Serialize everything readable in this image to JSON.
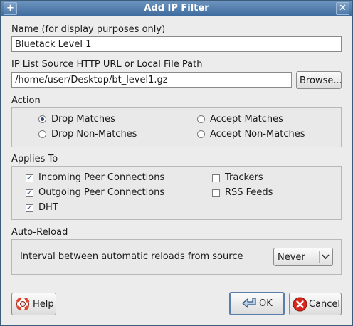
{
  "window": {
    "title": "Add IP Filter",
    "menu_icon": "plus-icon",
    "close_icon": "close-icon"
  },
  "name_field": {
    "label": "Name (for display purposes only)",
    "value": "Bluetack Level 1"
  },
  "source_field": {
    "label": "IP List Source HTTP URL or Local File Path",
    "value": "/home/user/Desktop/bt_level1.gz",
    "browse_label": "Browse..."
  },
  "action": {
    "label": "Action",
    "options": [
      {
        "label": "Drop Matches",
        "selected": true
      },
      {
        "label": "Accept Matches",
        "selected": false
      },
      {
        "label": "Drop Non-Matches",
        "selected": false
      },
      {
        "label": "Accept Non-Matches",
        "selected": false
      }
    ]
  },
  "applies_to": {
    "label": "Applies To",
    "options": [
      {
        "label": "Incoming Peer Connections",
        "checked": true
      },
      {
        "label": "Outgoing Peer Connections",
        "checked": true
      },
      {
        "label": "DHT",
        "checked": true
      },
      {
        "label": "Trackers",
        "checked": false
      },
      {
        "label": "RSS Feeds",
        "checked": false
      }
    ]
  },
  "auto_reload": {
    "label": "Auto-Reload",
    "interval_label": "Interval between automatic reloads from source",
    "interval_value": "Never"
  },
  "buttons": {
    "help": "Help",
    "ok": "OK",
    "cancel": "Cancel"
  },
  "colors": {
    "titlebar": "#4f7aa8",
    "cancel_icon": "#d8261c",
    "help_icon": "#e0442a"
  }
}
